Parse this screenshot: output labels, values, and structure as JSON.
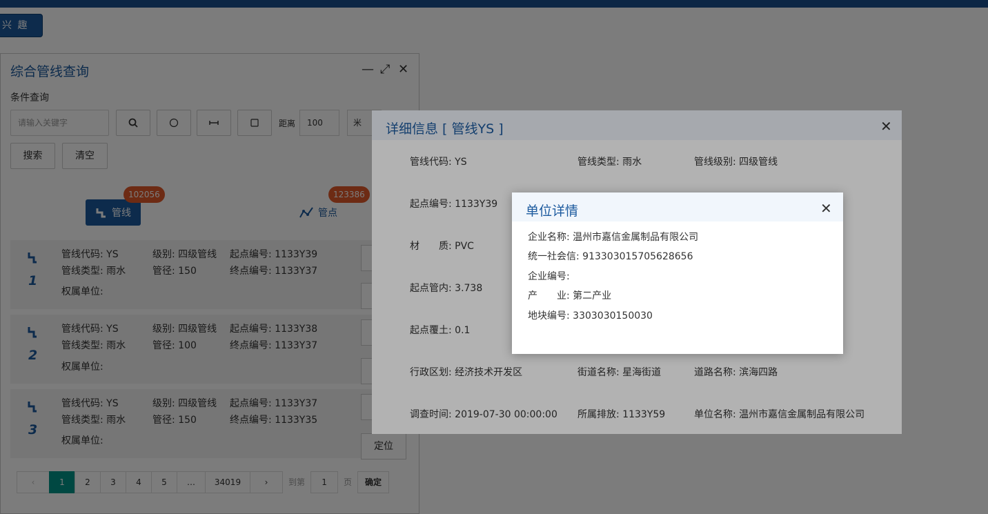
{
  "poi_button": "兴 趣 点",
  "panel": {
    "title": "综合管线查询",
    "controls": {
      "minimize": "—",
      "maximize": "⤢",
      "close": "✕"
    },
    "section_label": "条件查询",
    "keyword_placeholder": "请输入关键字",
    "distance_label": "距离",
    "distance_value": "100",
    "unit_value": "米",
    "search_label": "搜索",
    "clear_label": "清空",
    "tabs": [
      {
        "label": "管线",
        "count": "102056"
      },
      {
        "label": "管点",
        "count": "123386"
      }
    ],
    "results": [
      {
        "num": "1",
        "code": "管线代码: YS",
        "type": "管线类型: 雨水",
        "level": "级别: 四级管线",
        "diameter": "管径: 150",
        "start": "起点编号: 1133Y39",
        "end": "终点编号: 1133Y37",
        "owner": "权属单位:"
      },
      {
        "num": "2",
        "code": "管线代码: YS",
        "type": "管线类型: 雨水",
        "level": "级别: 四级管线",
        "diameter": "管径: 100",
        "start": "起点编号: 1133Y38",
        "end": "终点编号: 1133Y37",
        "owner": "权属单位:"
      },
      {
        "num": "3",
        "code": "管线代码: YS",
        "type": "管线类型: 雨水",
        "level": "级别: 四级管线",
        "diameter": "管径: 150",
        "start": "起点编号: 1133Y37",
        "end": "终点编号: 1133Y35",
        "owner": "权属单位:",
        "locate": "定位"
      }
    ],
    "pagination": {
      "prev": "‹",
      "pages": [
        "1",
        "2",
        "3",
        "4",
        "5",
        "…",
        "34019"
      ],
      "next": "›",
      "goto_label": "到第",
      "goto_value": "1",
      "page_label": "页",
      "confirm": "确定"
    }
  },
  "detail": {
    "title": "详细信息 [ 管线YS ]",
    "close": "✕",
    "fields": {
      "code": "管线代码: YS",
      "type": "管线类型: 雨水",
      "level": "管线级别: 四级管线",
      "start_no": "起点编号: 1133Y39",
      "material": "材　　质: PVC",
      "start_inner": "起点管内: 3.738",
      "start_cover": "起点覆土: 0.1",
      "district": "行政区划: 经济技术开发区",
      "street": "街道名称: 星海街道",
      "road": "道路名称: 滨海四路",
      "survey_time": "调查时间: 2019-07-30 00:00:00",
      "outlet": "所属排放: 1133Y59",
      "unit": "单位名称: 温州市嘉信金属制品有限公司"
    }
  },
  "unit_dialog": {
    "title": "单位详情",
    "close": "✕",
    "lines": [
      "企业名称: 温州市嘉信金属制品有限公司",
      "统一社会信: 913303015705628656",
      "企业编号:",
      "产　　业: 第二产业",
      "地块编号: 3303030150030"
    ]
  }
}
